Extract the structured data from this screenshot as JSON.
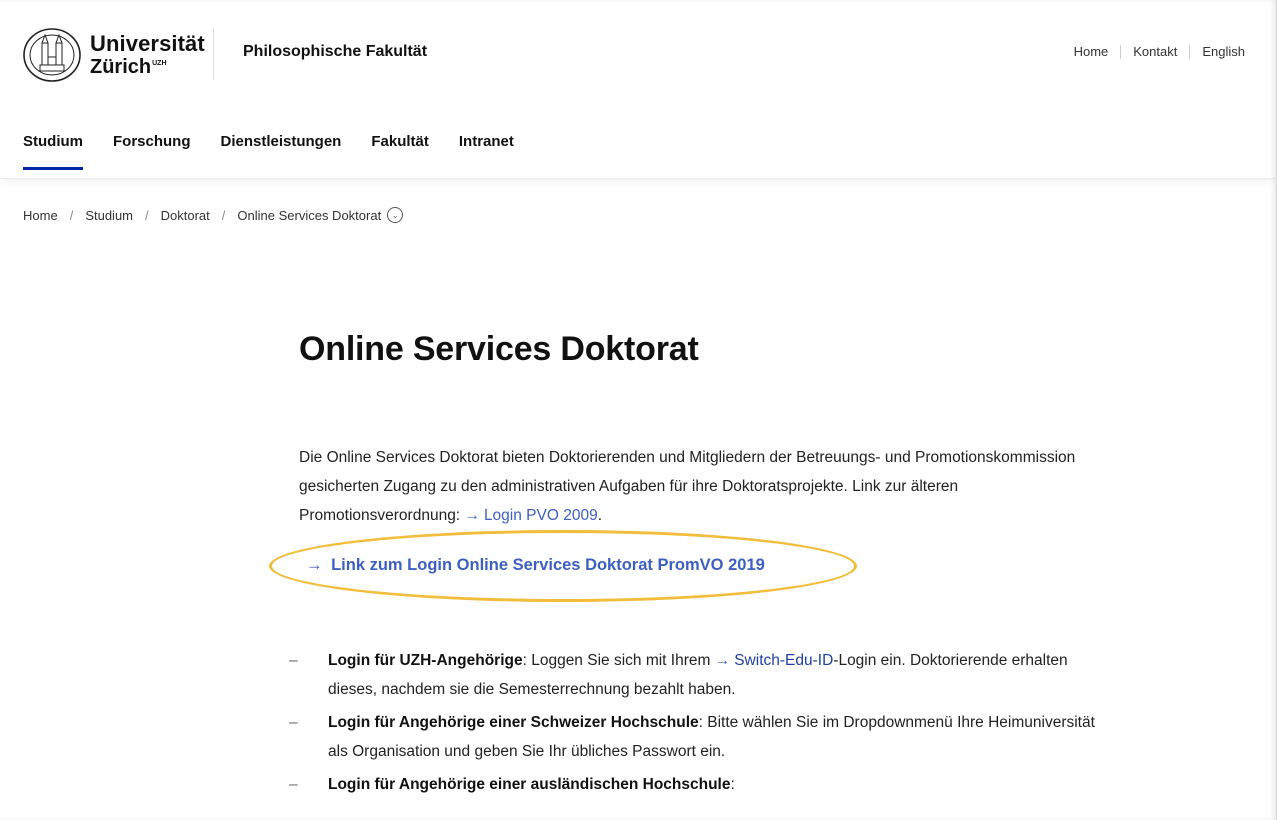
{
  "logo": {
    "line1": "Universität",
    "line2": "Zürich",
    "suffix": "UZH"
  },
  "header": {
    "faculty": "Philosophische Fakultät",
    "utility": [
      "Home",
      "Kontakt",
      "English"
    ]
  },
  "nav": [
    "Studium",
    "Forschung",
    "Dienstleistungen",
    "Fakultät",
    "Intranet"
  ],
  "breadcrumb": [
    "Home",
    "Studium",
    "Doktorat",
    "Online Services Doktorat"
  ],
  "page": {
    "title": "Online Services Doktorat",
    "intro": "Die Online Services Doktorat bieten Doktorierenden und Mitgliedern der Betreuungs- und Promotionskommission gesicherten Zugang zu den administrativen Aufgaben für ihre Doktoratsprojekte. Link zur älteren Promotionsverordnung:",
    "intro_link": "Login PVO 2009",
    "intro_end": ".",
    "login_link": "Link zum Login Online Services Doktorat PromVO 2019",
    "bullets": [
      {
        "label": "Login für UZH-Angehörige",
        "text_before": ": Loggen Sie sich mit Ihrem",
        "link": "Switch-Edu-ID",
        "text_after": "-Login ein. Doktorierende erhalten dieses, nachdem sie die Semesterrechnung bezahlt haben."
      },
      {
        "label": "Login für Angehörige einer Schweizer Hochschule",
        "text": ": Bitte wählen Sie im Dropdownmenü Ihre Heimuniversität als Organisation und geben Sie Ihr übliches Passwort ein."
      },
      {
        "label": "Login für Angehörige einer ausländischen Hochschule",
        "text": ":"
      }
    ]
  },
  "colors": {
    "accent": "#0028a5",
    "link": "#3d5fc4",
    "highlight": "#f2bd3a"
  }
}
